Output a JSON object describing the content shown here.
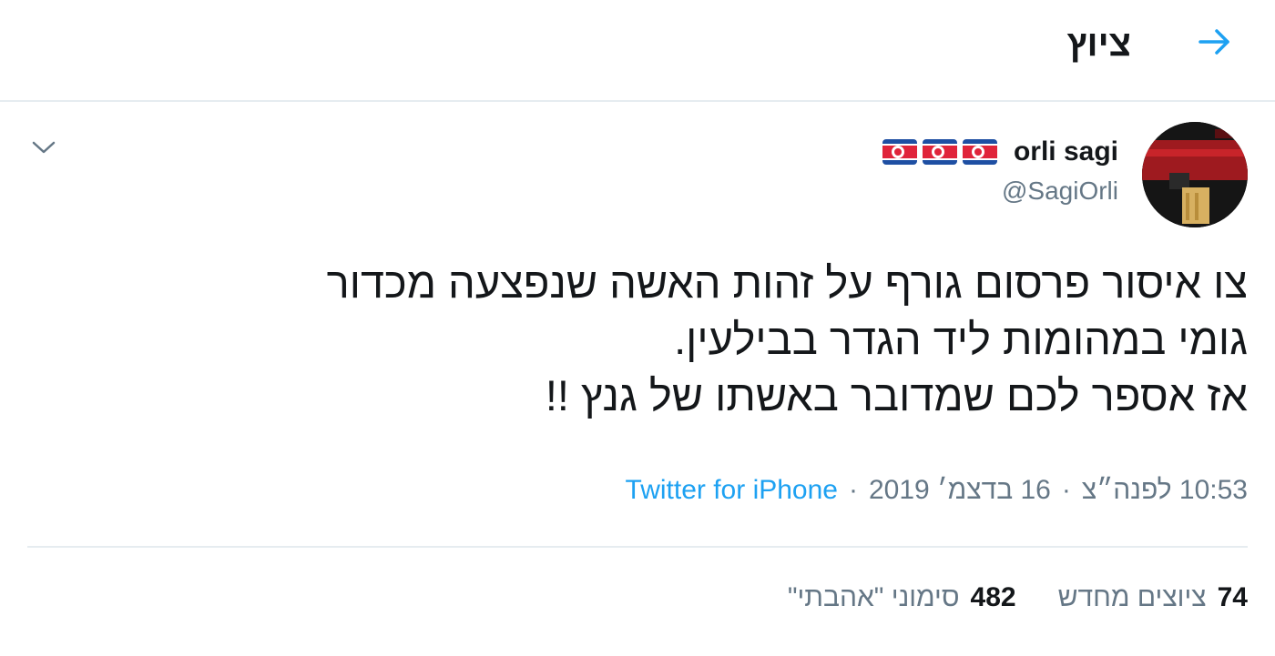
{
  "header": {
    "title": "ציוץ",
    "back_icon": "arrow-right-icon",
    "accent_color": "#1da1f2"
  },
  "tweet": {
    "author": {
      "name": "orli sagi",
      "handle": "@SagiOrli",
      "flag_icons": [
        "north-korea-flag-icon",
        "north-korea-flag-icon",
        "north-korea-flag-icon"
      ]
    },
    "text_lines": [
      "צו איסור פרסום גורף על זהות האשה שנפצעה מכדור",
      "גומי במהומות ליד הגדר בבילעין.",
      "אז אספר לכם שמדובר באשתו של גנץ !!"
    ],
    "meta": {
      "time": "10:53 לפנה״צ",
      "date": "16 בדצמ׳ 2019",
      "separator": "·",
      "source": "Twitter for iPhone"
    },
    "stats": {
      "retweets_count": "74",
      "retweets_label": "ציוצים מחדש",
      "likes_count": "482",
      "likes_label": "סימוני \"אהבתי\""
    }
  },
  "colors": {
    "text_primary": "#14171a",
    "text_secondary": "#657786",
    "link": "#1da1f2",
    "border": "#e6ecf0"
  }
}
